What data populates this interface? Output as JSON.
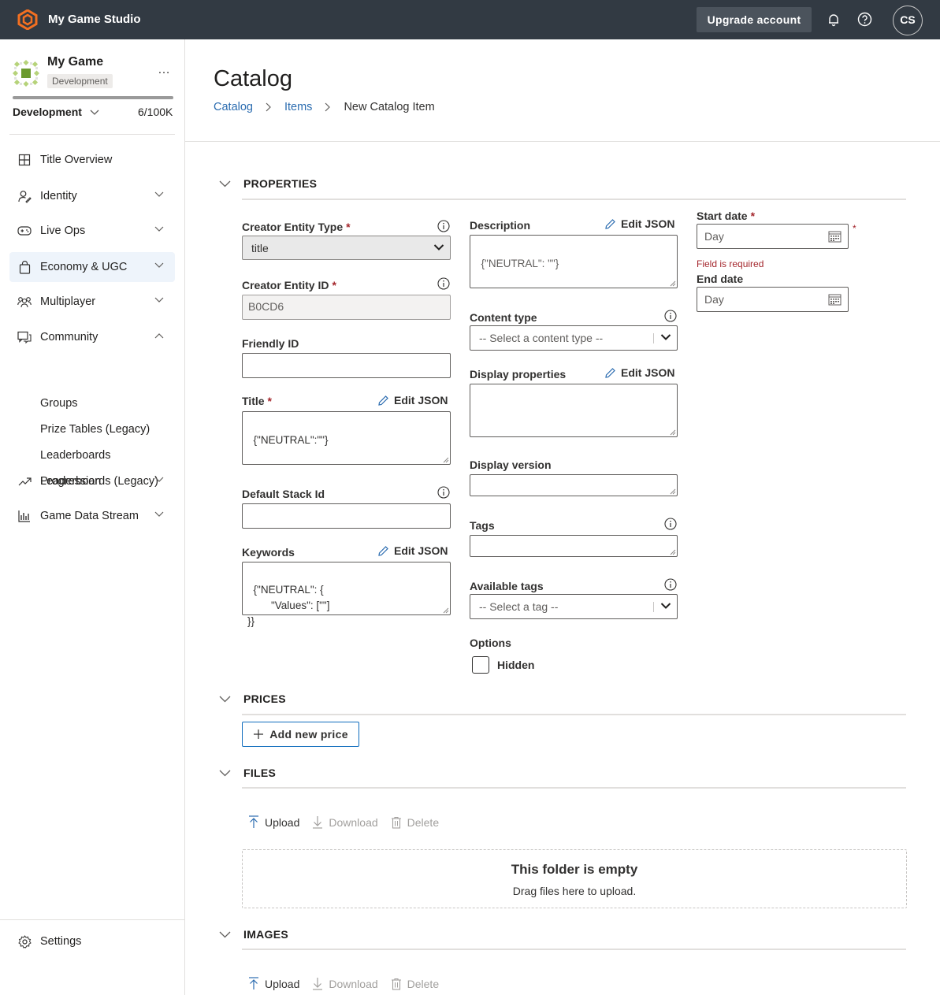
{
  "app": {
    "studio_name": "My Game Studio",
    "upgrade_label": "Upgrade account",
    "user_initials": "CS",
    "icons": [
      "playfab-logo-icon",
      "bell-icon",
      "help-icon"
    ]
  },
  "sidebar": {
    "game_name": "My Game",
    "environment_badge": "Development",
    "more_label": "…",
    "environment": "Development",
    "usage": "6/100K",
    "usage_fraction": 6e-05,
    "items": [
      {
        "label": "Title Overview",
        "icon": "grid-icon"
      },
      {
        "label": "Identity",
        "icon": "identity-icon"
      },
      {
        "label": "Live Ops",
        "icon": "gamepad-icon"
      },
      {
        "label": "Economy & UGC",
        "icon": "bag-icon",
        "active": true
      },
      {
        "label": "Multiplayer",
        "icon": "people-icon"
      },
      {
        "label": "Community",
        "icon": "chat-icon",
        "expanded": true
      },
      {
        "label": "Progression",
        "icon": "trending-icon"
      },
      {
        "label": "Game Data Stream",
        "icon": "bar-chart-icon"
      }
    ],
    "community_subitems": [
      "Groups",
      "Prize Tables (Legacy)",
      "Leaderboards",
      "Leaderboards (Legacy)"
    ],
    "settings_label": "Settings"
  },
  "page": {
    "title": "Catalog",
    "breadcrumb": [
      "Catalog",
      "Items",
      "New Catalog Item"
    ]
  },
  "properties": {
    "section_label": "PROPERTIES",
    "edit_json_label": "Edit JSON",
    "required_mark": "*",
    "creator_entity_type": {
      "label": "Creator Entity Type",
      "value": "title"
    },
    "creator_entity_id": {
      "label": "Creator Entity ID",
      "value": "B0CD6"
    },
    "friendly_id": {
      "label": "Friendly ID",
      "value": ""
    },
    "title": {
      "label": "Title",
      "value": "{\"NEUTRAL\":\"\"}"
    },
    "default_stack_id": {
      "label": "Default Stack Id",
      "value": ""
    },
    "keywords": {
      "label": "Keywords",
      "value": "{\"NEUTRAL\": {\n        \"Values\": [\"\"]\n}}"
    },
    "description": {
      "label": "Description",
      "value": "{\"NEUTRAL\": \"\"}"
    },
    "content_type": {
      "label": "Content type",
      "placeholder": "-- Select a content type --"
    },
    "display_properties": {
      "label": "Display properties",
      "value": ""
    },
    "display_version": {
      "label": "Display version",
      "value": ""
    },
    "tags": {
      "label": "Tags",
      "value": ""
    },
    "available_tags": {
      "label": "Available tags",
      "placeholder": "-- Select a tag --"
    },
    "options": {
      "label": "Options",
      "hidden_label": "Hidden",
      "hidden_checked": false
    },
    "start_date": {
      "label": "Start date",
      "placeholder": "Day",
      "error": "Field is required"
    },
    "end_date": {
      "label": "End date",
      "placeholder": "Day"
    }
  },
  "prices": {
    "section_label": "PRICES",
    "add_label": "Add new price"
  },
  "files": {
    "section_label": "FILES",
    "upload_label": "Upload",
    "download_label": "Download",
    "delete_label": "Delete",
    "empty_title": "This folder is empty",
    "empty_hint": "Drag files here to upload."
  },
  "images": {
    "section_label": "IMAGES",
    "upload_label": "Upload",
    "download_label": "Download",
    "delete_label": "Delete"
  }
}
